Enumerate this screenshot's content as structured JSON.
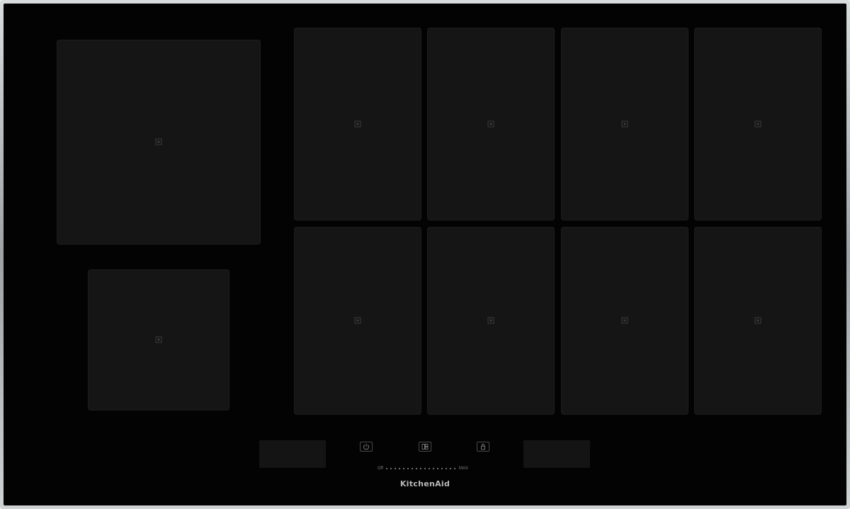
{
  "appliance": {
    "brand_logo": "KitchenAid",
    "type": "induction cooktop"
  },
  "cooking_zones": [
    {
      "id": "flexi-large-left",
      "marker": "zone-center-marker"
    },
    {
      "id": "small-left",
      "marker": "zone-center-marker"
    },
    {
      "id": "r1c1",
      "marker": "zone-center-marker"
    },
    {
      "id": "r1c2",
      "marker": "zone-center-marker"
    },
    {
      "id": "r1c3",
      "marker": "zone-center-marker"
    },
    {
      "id": "r1c4",
      "marker": "zone-center-marker"
    },
    {
      "id": "r2c1",
      "marker": "zone-center-marker"
    },
    {
      "id": "r2c2",
      "marker": "zone-center-marker"
    },
    {
      "id": "r2c3",
      "marker": "zone-center-marker"
    },
    {
      "id": "r2c4",
      "marker": "zone-center-marker"
    }
  ],
  "controls": {
    "power_icon": "power-icon",
    "display_icon": "zone-display-icon",
    "lock_icon": "lock-icon",
    "slider": {
      "min_label": "Off",
      "max_label": "MAX"
    }
  },
  "colors": {
    "glass": "#030303",
    "zone": "#151515",
    "frame": "#b5b8ba",
    "control_outline": "#4a4a4a"
  }
}
